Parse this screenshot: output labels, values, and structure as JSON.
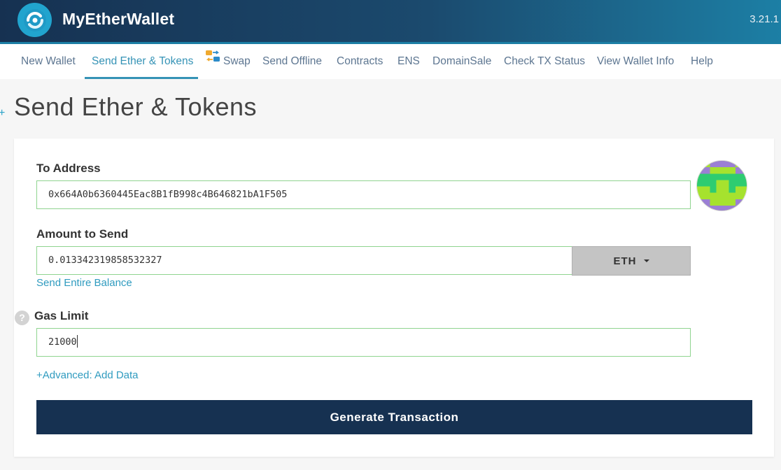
{
  "app": {
    "name": "MyEtherWallet",
    "version": "3.21.1"
  },
  "nav": {
    "items": [
      {
        "label": "New Wallet"
      },
      {
        "label": "Send Ether & Tokens"
      },
      {
        "label": "Swap"
      },
      {
        "label": "Send Offline"
      },
      {
        "label": "Contracts"
      },
      {
        "label": "ENS"
      },
      {
        "label": "DomainSale"
      },
      {
        "label": "Check TX Status"
      },
      {
        "label": "View Wallet Info"
      },
      {
        "label": "Help"
      }
    ],
    "active_index": 1
  },
  "page": {
    "title": "Send Ether & Tokens",
    "plus_mark": "+"
  },
  "form": {
    "to_address": {
      "label": "To Address",
      "value": "0x664A0b6360445Eac8B1fB998c4B646821bA1F505"
    },
    "amount": {
      "label": "Amount to Send",
      "value": "0.013342319858532327",
      "currency": "ETH",
      "send_entire_balance": "Send Entire Balance"
    },
    "gas_limit": {
      "label": "Gas Limit",
      "value": "21000",
      "help_icon_text": "?"
    },
    "advanced_link": "+Advanced: Add Data",
    "generate_button": "Generate Transaction"
  },
  "colors": {
    "header_dark": "#163151",
    "header_light": "#1c7fa5",
    "accent": "#3593b6",
    "input_border_valid": "#8fd48f",
    "button_primary": "#163151"
  },
  "icons": {
    "logo": "mew-logo-icon",
    "swap": "swap-icon",
    "help": "question-circle-icon",
    "identicon": "address-identicon-icon",
    "dropdown": "caret-down-icon"
  }
}
